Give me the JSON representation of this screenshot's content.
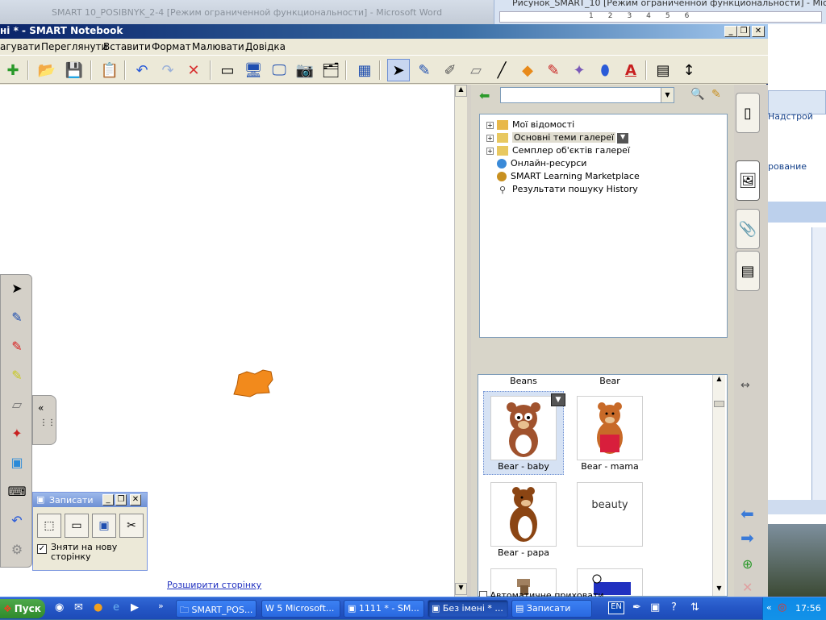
{
  "background": {
    "word_title": "SMART 10_POSIBNYK_2-4 [Режим ограниченной функциональности] - Microsoft Word",
    "ruler_text": "Рисунок_SMART_10 [Режим ограниченной функциональности] - Microsoft",
    "word_ribbon": {
      "item1": "Надстрой",
      "item2": "рование"
    }
  },
  "window": {
    "title": "ні * - SMART Notebook"
  },
  "menu": [
    "агувати",
    "Переглянути",
    "Вставити",
    "Формат",
    "Малювати",
    "Довідка"
  ],
  "gallery": {
    "search_value": "",
    "tree": [
      {
        "label": "Мої відомості",
        "icon": "folder-star-icon",
        "expandable": true
      },
      {
        "label": "Основні теми галереї",
        "icon": "folder-icon",
        "expandable": true,
        "selected": true
      },
      {
        "label": "Семплер об'єктів галереї",
        "icon": "folder-icon",
        "expandable": true
      },
      {
        "label": "Онлайн-ресурси",
        "icon": "globe-icon",
        "expandable": false
      },
      {
        "label": "SMART Learning Marketplace",
        "icon": "marketplace-icon",
        "expandable": false
      },
      {
        "label": "Результати пошуку History",
        "icon": "search-result-icon",
        "expandable": false
      }
    ],
    "column_headers": [
      "Beans",
      "Bear"
    ],
    "items": [
      {
        "label": "Bear - baby",
        "selected": true
      },
      {
        "label": "Bear - mama",
        "selected": false
      },
      {
        "label": "Bear - papa",
        "selected": false
      },
      {
        "label": "beauty",
        "selected": false,
        "text_thumb": "beauty"
      }
    ],
    "auto_checkbox_label": "Автоматичне приховати"
  },
  "canvas": {
    "extend_link": "Розширити сторінку"
  },
  "capture": {
    "title": "Записати",
    "checkbox_label": "Зняти на нову сторінку",
    "checked": true
  },
  "taskbar": {
    "start": "Пуск",
    "tasks": [
      {
        "label": "SMART_POS...",
        "icon": "folder-icon",
        "active": false
      },
      {
        "label": "5 Microsoft...",
        "icon": "word-icon",
        "active": false
      },
      {
        "label": "1111 * - SM...",
        "icon": "notebook-icon",
        "active": false
      },
      {
        "label": "Без імені * ...",
        "icon": "notebook-icon",
        "active": true
      },
      {
        "label": "Записати",
        "icon": "capture-icon",
        "active": false
      }
    ],
    "lang": "EN",
    "time": "17:56"
  },
  "colors": {
    "accent": "#0a246a",
    "shape_fill": "#f28a1c",
    "taskbar": "#245edb"
  }
}
